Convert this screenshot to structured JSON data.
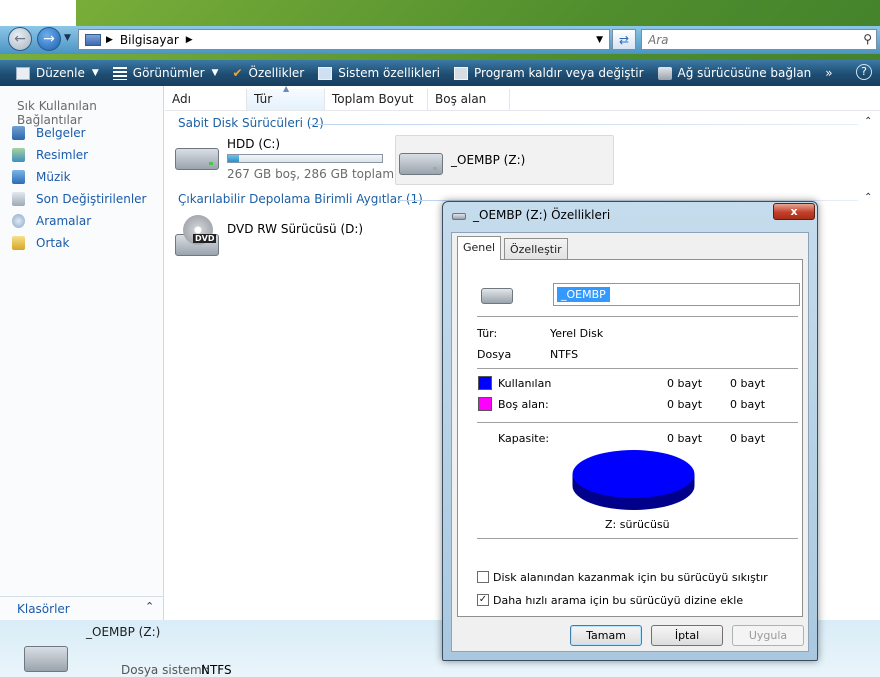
{
  "address": {
    "path": "Bilgisayar",
    "search_placeholder": "Ara"
  },
  "toolbar": {
    "organize": "Düzenle",
    "views": "Görünümler",
    "properties": "Özellikler",
    "system_properties": "Sistem özellikleri",
    "uninstall": "Program kaldır veya değiştir",
    "map_drive": "Ağ sürücüsüne bağlan",
    "more": "»",
    "help": "?"
  },
  "sidebar": {
    "title": "Sık Kullanılan Bağlantılar",
    "items": [
      {
        "label": "Belgeler",
        "icon": "documents-icon"
      },
      {
        "label": "Resimler",
        "icon": "pictures-icon"
      },
      {
        "label": "Müzik",
        "icon": "music-icon"
      },
      {
        "label": "Son Değiştirilenler",
        "icon": "recent-icon"
      },
      {
        "label": "Aramalar",
        "icon": "searches-icon"
      },
      {
        "label": "Ortak",
        "icon": "public-folder-icon"
      }
    ],
    "folders": "Klasörler"
  },
  "columns": [
    "Adı",
    "Tür",
    "Toplam Boyut",
    "Boş alan"
  ],
  "groups": {
    "hdd": "Sabit Disk Sürücüleri (2)",
    "removable": "Çıkarılabilir Depolama Birimli Aygıtlar (1)"
  },
  "drives": {
    "c": {
      "name": "HDD (C:)",
      "info": "267 GB boş, 286 GB toplam",
      "used_fraction": 0.07
    },
    "z": {
      "name": "_OEMBP (Z:)"
    },
    "d": {
      "name": "DVD RW Sürücüsü (D:)",
      "badge": "DVD"
    }
  },
  "details": {
    "name": "_OEMBP (Z:)",
    "label": "Dosya sistemi:",
    "value": "NTFS"
  },
  "dialog": {
    "title": "_OEMBP (Z:) Özellikleri",
    "close": "x",
    "tabs": [
      "Genel",
      "Özelleştir"
    ],
    "volume_name": "_OEMBP",
    "type_label": "Tür:",
    "type_value": "Yerel Disk",
    "fs_label": "Dosya",
    "fs_value": "NTFS",
    "used_label": "Kullanılan",
    "used_bytes": "0 bayt",
    "used_size": "0 bayt",
    "free_label": "Boş alan:",
    "free_bytes": "0 bayt",
    "free_size": "0 bayt",
    "capacity_label": "Kapasite:",
    "capacity_bytes": "0 bayt",
    "capacity_size": "0 bayt",
    "drive_caption": "Z: sürücüsü",
    "compress_label": "Disk alanından kazanmak için bu sürücüyü sıkıştır",
    "index_label": "Daha hızlı arama için bu sürücüyü dizine ekle",
    "compress_checked": false,
    "index_checked": true,
    "ok": "Tamam",
    "cancel": "İptal",
    "apply": "Uygula",
    "colors": {
      "used": "#0000ff",
      "free": "#ff00ff"
    }
  }
}
